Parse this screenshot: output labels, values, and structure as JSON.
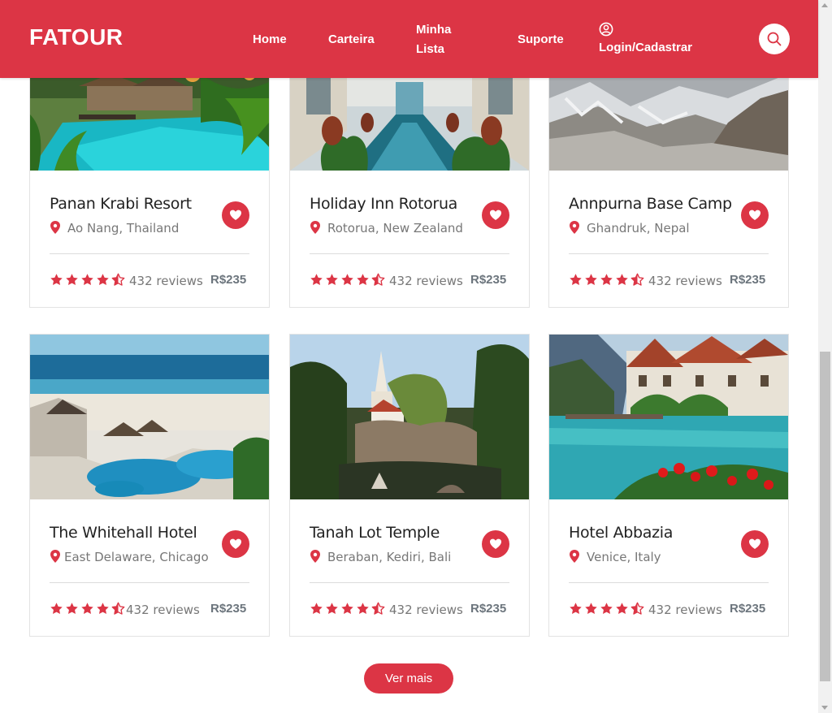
{
  "navbar": {
    "brand": "FATOUR",
    "links": {
      "home": "Home",
      "wallet": "Carteira",
      "my_list_line1": "Minha",
      "my_list_line2": "Lista",
      "support": "Suporte",
      "login": "Login/Cadastrar"
    },
    "icons": {
      "user": "user-circle-icon",
      "search": "search-icon"
    },
    "color": "#dc3545"
  },
  "cards": [
    {
      "title": "Panan Krabi Resort",
      "location": "Ao Nang, Thailand",
      "rating": 4.5,
      "reviews": "432 reviews",
      "price": "R$235"
    },
    {
      "title": "Holiday Inn Rotorua",
      "location": "Rotorua, New Zealand",
      "rating": 4.5,
      "reviews": "432 reviews",
      "price": "R$235"
    },
    {
      "title": "Annpurna Base Camp",
      "location": "Ghandruk, Nepal",
      "rating": 4.5,
      "reviews": "432 reviews",
      "price": "R$235"
    },
    {
      "title": "The Whitehall Hotel",
      "location": "East Delaware, Chicago",
      "rating": 4.5,
      "reviews": "432 reviews",
      "price": "R$235"
    },
    {
      "title": "Tanah Lot Temple",
      "location": "Beraban, Kediri, Bali",
      "rating": 4.5,
      "reviews": "432 reviews",
      "price": "R$235"
    },
    {
      "title": "Hotel Abbazia",
      "location": "Venice, Italy",
      "rating": 4.5,
      "reviews": "432 reviews",
      "price": "R$235"
    }
  ],
  "more_button": "Ver mais",
  "accent_color": "#dc3545"
}
